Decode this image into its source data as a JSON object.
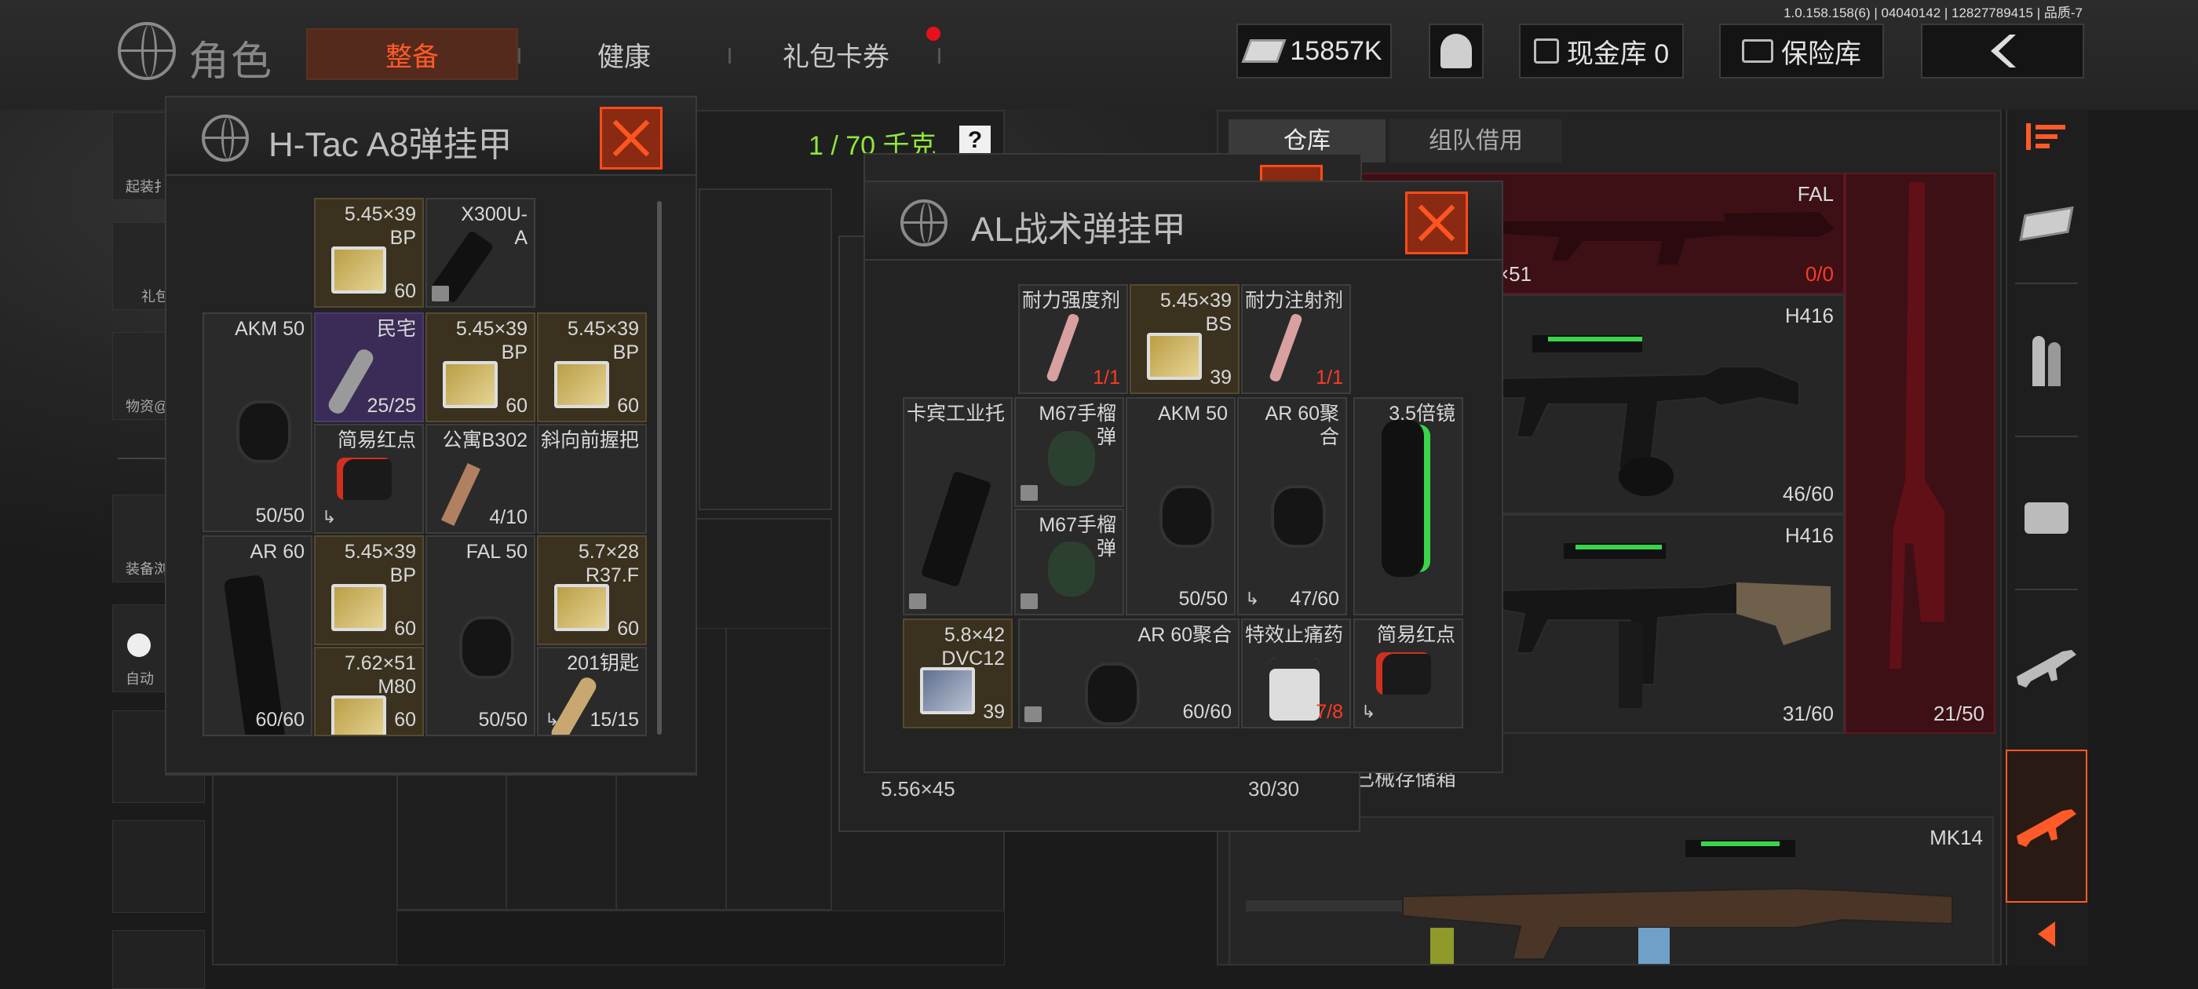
{
  "version": "1.0.158.158(6) | 04040142 | 12827789415 | 品质-7",
  "header": {
    "title": "角色",
    "tabs": [
      {
        "label": "整备",
        "active": true
      },
      {
        "label": "健康",
        "active": false
      },
      {
        "label": "礼包卡券",
        "active": false
      }
    ],
    "money": "15857K",
    "cash_vault": "现金库 0",
    "safe_vault": "保险库"
  },
  "sidebar_left": [
    {
      "label": "起装扌"
    },
    {
      "label": "礼包"
    },
    {
      "label": "物资@"
    },
    {
      "label": "装备浏"
    },
    {
      "label": "自动"
    }
  ],
  "weight": {
    "value": "1 / 70 千克",
    "help": "?"
  },
  "storage_tabs": [
    {
      "label": "仓库",
      "active": true
    },
    {
      "label": "组队借用",
      "active": false
    }
  ],
  "htac": {
    "title": "H-Tac A8弹挂甲",
    "cells": [
      {
        "name": "5.45×39\nBP",
        "count": "60",
        "kind": "ammo"
      },
      {
        "name": "X300U-\nA",
        "count": "",
        "kind": "light",
        "badge": true
      },
      {
        "name": "AKM 50",
        "count": "50/50",
        "kind": "drum"
      },
      {
        "name": "民宅",
        "count": "25/25",
        "kind": "key"
      },
      {
        "name": "5.45×39\nBP",
        "count": "60",
        "kind": "ammo"
      },
      {
        "name": "5.45×39\nBP",
        "count": "60",
        "kind": "ammo"
      },
      {
        "name": "简易红点",
        "count": "",
        "kind": "sight",
        "arrow": true
      },
      {
        "name": "公寓B302",
        "count": "4/10",
        "kind": "keycard"
      },
      {
        "name": "斜向前握把",
        "count": "",
        "kind": "grip"
      },
      {
        "name": "AR 60",
        "count": "60/60",
        "kind": "mag"
      },
      {
        "name": "5.45×39\nBP",
        "count": "60",
        "kind": "ammo"
      },
      {
        "name": "FAL 50",
        "count": "50/50",
        "kind": "drum"
      },
      {
        "name": "5.7×28\nR37.F",
        "count": "60",
        "kind": "ammo"
      },
      {
        "name": "7.62×51\nM80",
        "count": "60",
        "kind": "ammo"
      },
      {
        "name": "201钥匙",
        "count": "15/15",
        "kind": "keyb",
        "arrow": true
      }
    ]
  },
  "ghost": {
    "left_count": "5.56×45",
    "right_count": "30/30"
  },
  "al": {
    "title": "AL战术弹挂甲",
    "cells": [
      {
        "name": "耐力强度剂",
        "count": "1/1",
        "kind": "syringe",
        "red": true
      },
      {
        "name": "5.45×39\nBS",
        "count": "39",
        "kind": "ammo"
      },
      {
        "name": "耐力注射剂",
        "count": "1/1",
        "kind": "syringe",
        "red": true
      },
      {
        "name": "卡宾工业托",
        "count": "",
        "kind": "stock",
        "badge": true
      },
      {
        "name": "M67手榴\n弹",
        "count": "",
        "kind": "grenade",
        "badge": true
      },
      {
        "name": "AKM 50",
        "count": "50/50",
        "kind": "drum"
      },
      {
        "name": "AR 60聚\n合",
        "count": "47/60",
        "kind": "drum2",
        "arrow": true
      },
      {
        "name": "3.5倍镜",
        "count": "",
        "kind": "scope"
      },
      {
        "name": "M67手榴\n弹",
        "count": "",
        "kind": "grenade",
        "badge": true
      },
      {
        "name": "5.8×42\nDVC12",
        "count": "39",
        "kind": "ammo2"
      },
      {
        "name": "AR 60聚合",
        "count": "60/60",
        "kind": "drum3",
        "badge": true
      },
      {
        "name": "特效止痛药",
        "count": "7/8",
        "kind": "pills",
        "red": true
      },
      {
        "name": "简易红点",
        "count": "",
        "kind": "sight",
        "arrow": true
      }
    ]
  },
  "storage": {
    "weapons": [
      {
        "name": "FAL",
        "count": "0/0",
        "count_red": true,
        "extra": "×51"
      },
      {
        "name": "H416",
        "count": "46/60"
      },
      {
        "name": "H416",
        "count": "31/60"
      },
      {
        "name": "",
        "count": "21/50"
      },
      {
        "name": "MK14",
        "count": ""
      }
    ],
    "section_label": "已械存储箱"
  },
  "colors": {
    "accent": "#ff5a28",
    "weight_green": "#8fe83a",
    "danger_red": "#ff3a24"
  },
  "icons": {
    "money": "cash-stack-icon",
    "avatar": "operator-icon",
    "back": "chevron-left-icon"
  },
  "sidebar_right": [
    {
      "icon": "sort-icon"
    },
    {
      "icon": "cash-icon"
    },
    {
      "icon": "ammo-icon"
    },
    {
      "icon": "crate-icon"
    },
    {
      "icon": "rifle-icon"
    },
    {
      "icon": "rifle-active-icon"
    },
    {
      "icon": "collapse-icon"
    }
  ]
}
